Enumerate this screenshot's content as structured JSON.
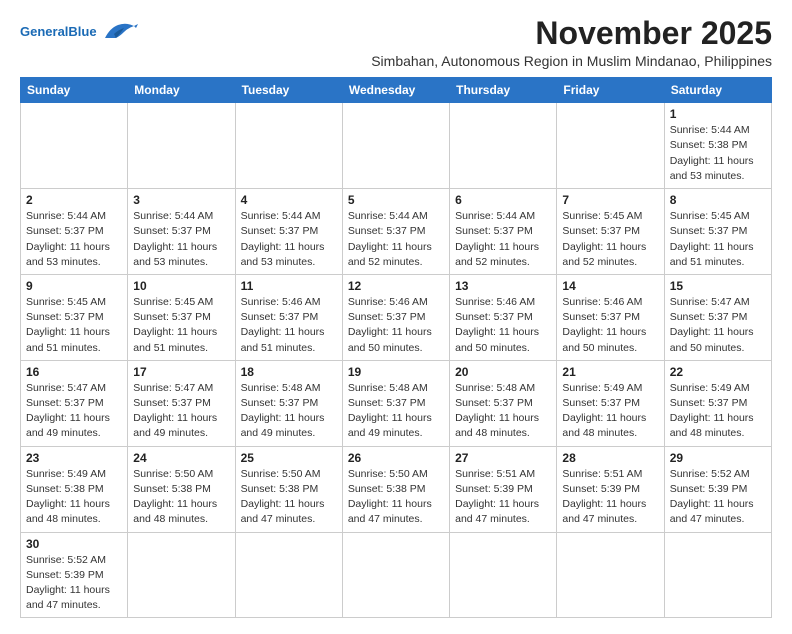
{
  "header": {
    "logo_general": "General",
    "logo_blue": "Blue",
    "month_title": "November 2025",
    "location": "Simbahan, Autonomous Region in Muslim Mindanao, Philippines"
  },
  "weekdays": [
    "Sunday",
    "Monday",
    "Tuesday",
    "Wednesday",
    "Thursday",
    "Friday",
    "Saturday"
  ],
  "weeks": [
    [
      {
        "day": "",
        "empty": true
      },
      {
        "day": "",
        "empty": true
      },
      {
        "day": "",
        "empty": true
      },
      {
        "day": "",
        "empty": true
      },
      {
        "day": "",
        "empty": true
      },
      {
        "day": "",
        "empty": true
      },
      {
        "day": "1",
        "sunrise": "5:44 AM",
        "sunset": "5:38 PM",
        "daylight": "11 hours and 53 minutes."
      }
    ],
    [
      {
        "day": "2",
        "sunrise": "5:44 AM",
        "sunset": "5:37 PM",
        "daylight": "11 hours and 53 minutes."
      },
      {
        "day": "3",
        "sunrise": "5:44 AM",
        "sunset": "5:37 PM",
        "daylight": "11 hours and 53 minutes."
      },
      {
        "day": "4",
        "sunrise": "5:44 AM",
        "sunset": "5:37 PM",
        "daylight": "11 hours and 53 minutes."
      },
      {
        "day": "5",
        "sunrise": "5:44 AM",
        "sunset": "5:37 PM",
        "daylight": "11 hours and 52 minutes."
      },
      {
        "day": "6",
        "sunrise": "5:44 AM",
        "sunset": "5:37 PM",
        "daylight": "11 hours and 52 minutes."
      },
      {
        "day": "7",
        "sunrise": "5:45 AM",
        "sunset": "5:37 PM",
        "daylight": "11 hours and 52 minutes."
      },
      {
        "day": "8",
        "sunrise": "5:45 AM",
        "sunset": "5:37 PM",
        "daylight": "11 hours and 51 minutes."
      }
    ],
    [
      {
        "day": "9",
        "sunrise": "5:45 AM",
        "sunset": "5:37 PM",
        "daylight": "11 hours and 51 minutes."
      },
      {
        "day": "10",
        "sunrise": "5:45 AM",
        "sunset": "5:37 PM",
        "daylight": "11 hours and 51 minutes."
      },
      {
        "day": "11",
        "sunrise": "5:46 AM",
        "sunset": "5:37 PM",
        "daylight": "11 hours and 51 minutes."
      },
      {
        "day": "12",
        "sunrise": "5:46 AM",
        "sunset": "5:37 PM",
        "daylight": "11 hours and 50 minutes."
      },
      {
        "day": "13",
        "sunrise": "5:46 AM",
        "sunset": "5:37 PM",
        "daylight": "11 hours and 50 minutes."
      },
      {
        "day": "14",
        "sunrise": "5:46 AM",
        "sunset": "5:37 PM",
        "daylight": "11 hours and 50 minutes."
      },
      {
        "day": "15",
        "sunrise": "5:47 AM",
        "sunset": "5:37 PM",
        "daylight": "11 hours and 50 minutes."
      }
    ],
    [
      {
        "day": "16",
        "sunrise": "5:47 AM",
        "sunset": "5:37 PM",
        "daylight": "11 hours and 49 minutes."
      },
      {
        "day": "17",
        "sunrise": "5:47 AM",
        "sunset": "5:37 PM",
        "daylight": "11 hours and 49 minutes."
      },
      {
        "day": "18",
        "sunrise": "5:48 AM",
        "sunset": "5:37 PM",
        "daylight": "11 hours and 49 minutes."
      },
      {
        "day": "19",
        "sunrise": "5:48 AM",
        "sunset": "5:37 PM",
        "daylight": "11 hours and 49 minutes."
      },
      {
        "day": "20",
        "sunrise": "5:48 AM",
        "sunset": "5:37 PM",
        "daylight": "11 hours and 48 minutes."
      },
      {
        "day": "21",
        "sunrise": "5:49 AM",
        "sunset": "5:37 PM",
        "daylight": "11 hours and 48 minutes."
      },
      {
        "day": "22",
        "sunrise": "5:49 AM",
        "sunset": "5:37 PM",
        "daylight": "11 hours and 48 minutes."
      }
    ],
    [
      {
        "day": "23",
        "sunrise": "5:49 AM",
        "sunset": "5:38 PM",
        "daylight": "11 hours and 48 minutes."
      },
      {
        "day": "24",
        "sunrise": "5:50 AM",
        "sunset": "5:38 PM",
        "daylight": "11 hours and 48 minutes."
      },
      {
        "day": "25",
        "sunrise": "5:50 AM",
        "sunset": "5:38 PM",
        "daylight": "11 hours and 47 minutes."
      },
      {
        "day": "26",
        "sunrise": "5:50 AM",
        "sunset": "5:38 PM",
        "daylight": "11 hours and 47 minutes."
      },
      {
        "day": "27",
        "sunrise": "5:51 AM",
        "sunset": "5:39 PM",
        "daylight": "11 hours and 47 minutes."
      },
      {
        "day": "28",
        "sunrise": "5:51 AM",
        "sunset": "5:39 PM",
        "daylight": "11 hours and 47 minutes."
      },
      {
        "day": "29",
        "sunrise": "5:52 AM",
        "sunset": "5:39 PM",
        "daylight": "11 hours and 47 minutes."
      }
    ],
    [
      {
        "day": "30",
        "sunrise": "5:52 AM",
        "sunset": "5:39 PM",
        "daylight": "11 hours and 47 minutes."
      },
      {
        "day": "",
        "empty": true
      },
      {
        "day": "",
        "empty": true
      },
      {
        "day": "",
        "empty": true
      },
      {
        "day": "",
        "empty": true
      },
      {
        "day": "",
        "empty": true
      },
      {
        "day": "",
        "empty": true
      }
    ]
  ]
}
